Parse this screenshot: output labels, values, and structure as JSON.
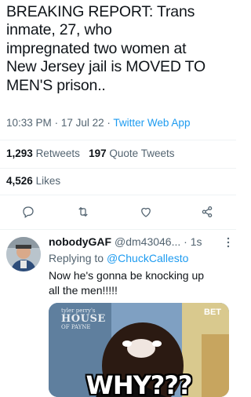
{
  "tweet": {
    "text_lines": [
      "BREAKING REPORT: Trans",
      "inmate, 27, who",
      "impregnated two women at",
      "New Jersey jail is MOVED TO",
      "MEN'S prison.."
    ],
    "time": "10:33 PM",
    "date": "17 Jul 22",
    "separator": "·",
    "source": "Twitter Web App"
  },
  "stats": {
    "retweets_count": "1,293",
    "retweets_label": "Retweets",
    "quote_count": "197",
    "quote_label": "Quote Tweets",
    "likes_count": "4,526",
    "likes_label": "Likes"
  },
  "actions": [
    {
      "icon": "reply-icon"
    },
    {
      "icon": "retweet-icon"
    },
    {
      "icon": "like-icon"
    },
    {
      "icon": "share-icon"
    }
  ],
  "reply": {
    "name": "nobodyGAF",
    "handle": "@dm43046...",
    "separator": "·",
    "time": "1s",
    "replying_prefix": "Replying to",
    "replying_to": "@ChuckCallesto",
    "text_lines": [
      "Now he's gonna be knocking up",
      "all the men!!!!!"
    ],
    "media": {
      "caption": "WHY???",
      "show_logo_small": "tyler perry's",
      "show_logo_big": "HOUSE",
      "show_logo_bottom": "OF PAYNE",
      "network_logo": "BET"
    }
  },
  "colors": {
    "link": "#1d9bf0",
    "secondary_text": "#536471",
    "primary_text": "#0f1419"
  }
}
